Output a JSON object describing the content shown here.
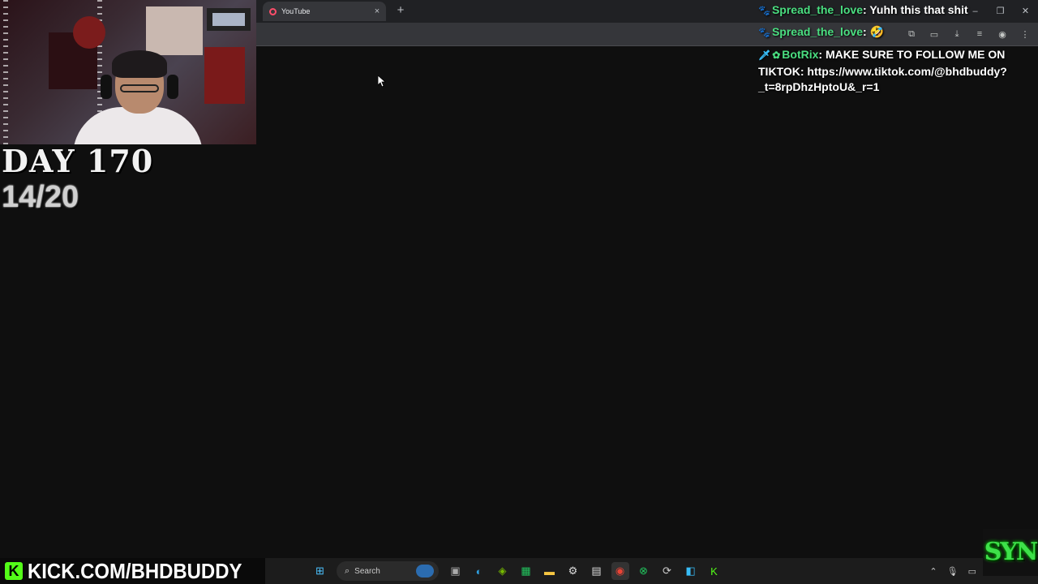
{
  "browser": {
    "tab_title": "YouTube",
    "tab_close": "×",
    "new_tab": "+",
    "window_controls": {
      "minimize": "–",
      "restore": "❐",
      "close": "✕"
    },
    "toolbar_icons": [
      "extension-icon",
      "cast-icon",
      "download-icon",
      "media-icon",
      "profile-icon",
      "menu-icon"
    ]
  },
  "overlay": {
    "day_label": "DAY 170",
    "counter": "14/20"
  },
  "chat": [
    {
      "user": "Spread_the_love",
      "message": "Yuhh this that shit",
      "badge": "paw"
    },
    {
      "user": "Spread_the_love",
      "message": "",
      "badge": "paw",
      "emote": "🤣"
    },
    {
      "user": "BotRix",
      "message": "MAKE SURE TO FOLLOW ME ON TIKTOK: https://www.tiktok.com/@bhdbuddy?_t=8rpDhzHptoU&_r=1",
      "badge": "bot"
    }
  ],
  "stream": {
    "kick_url": "KICK.COM/BHDBUDDY",
    "logo_text": "SYN"
  },
  "taskbar": {
    "search_label": "Search",
    "icons": [
      "windows-start-icon",
      "search-icon",
      "task-view-icon",
      "edge-icon",
      "nvidia-icon",
      "app-icon",
      "file-explorer-icon",
      "steam-icon",
      "store-icon",
      "chrome-icon",
      "xbox-icon",
      "settings-icon",
      "app-2-icon",
      "kick-icon"
    ]
  },
  "colors": {
    "page_bg": "#0f0f0f",
    "username": "#4ade80",
    "kick_green": "#53fc18",
    "syn_green": "#3ee04a"
  }
}
